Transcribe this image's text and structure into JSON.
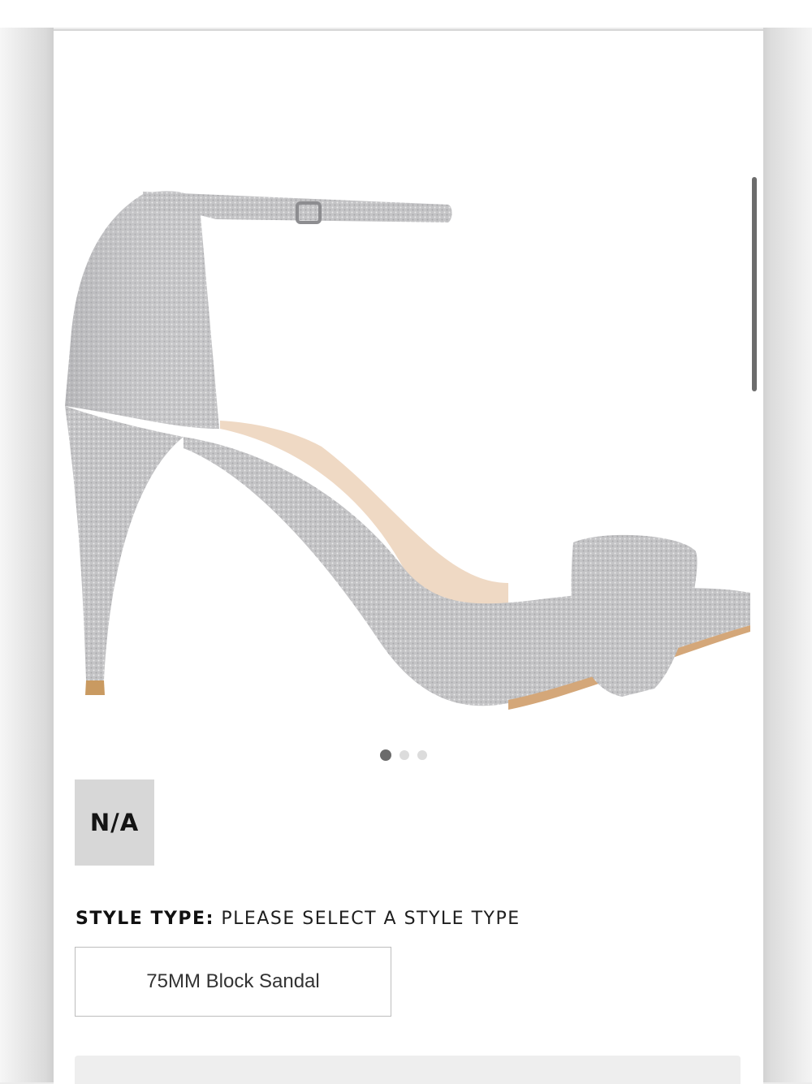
{
  "product": {
    "image_icon": "high-heel-sandal-icon",
    "image_color": "#c9c9cb",
    "carousel": {
      "count": 3,
      "active_index": 0
    }
  },
  "swatch": {
    "label": "N/A",
    "color": "#d7d7d7"
  },
  "style_type": {
    "key": "STYLE TYPE:",
    "value": "PLEASE SELECT A STYLE TYPE"
  },
  "options": [
    {
      "label": "75MM Block Sandal",
      "selected": false
    }
  ]
}
